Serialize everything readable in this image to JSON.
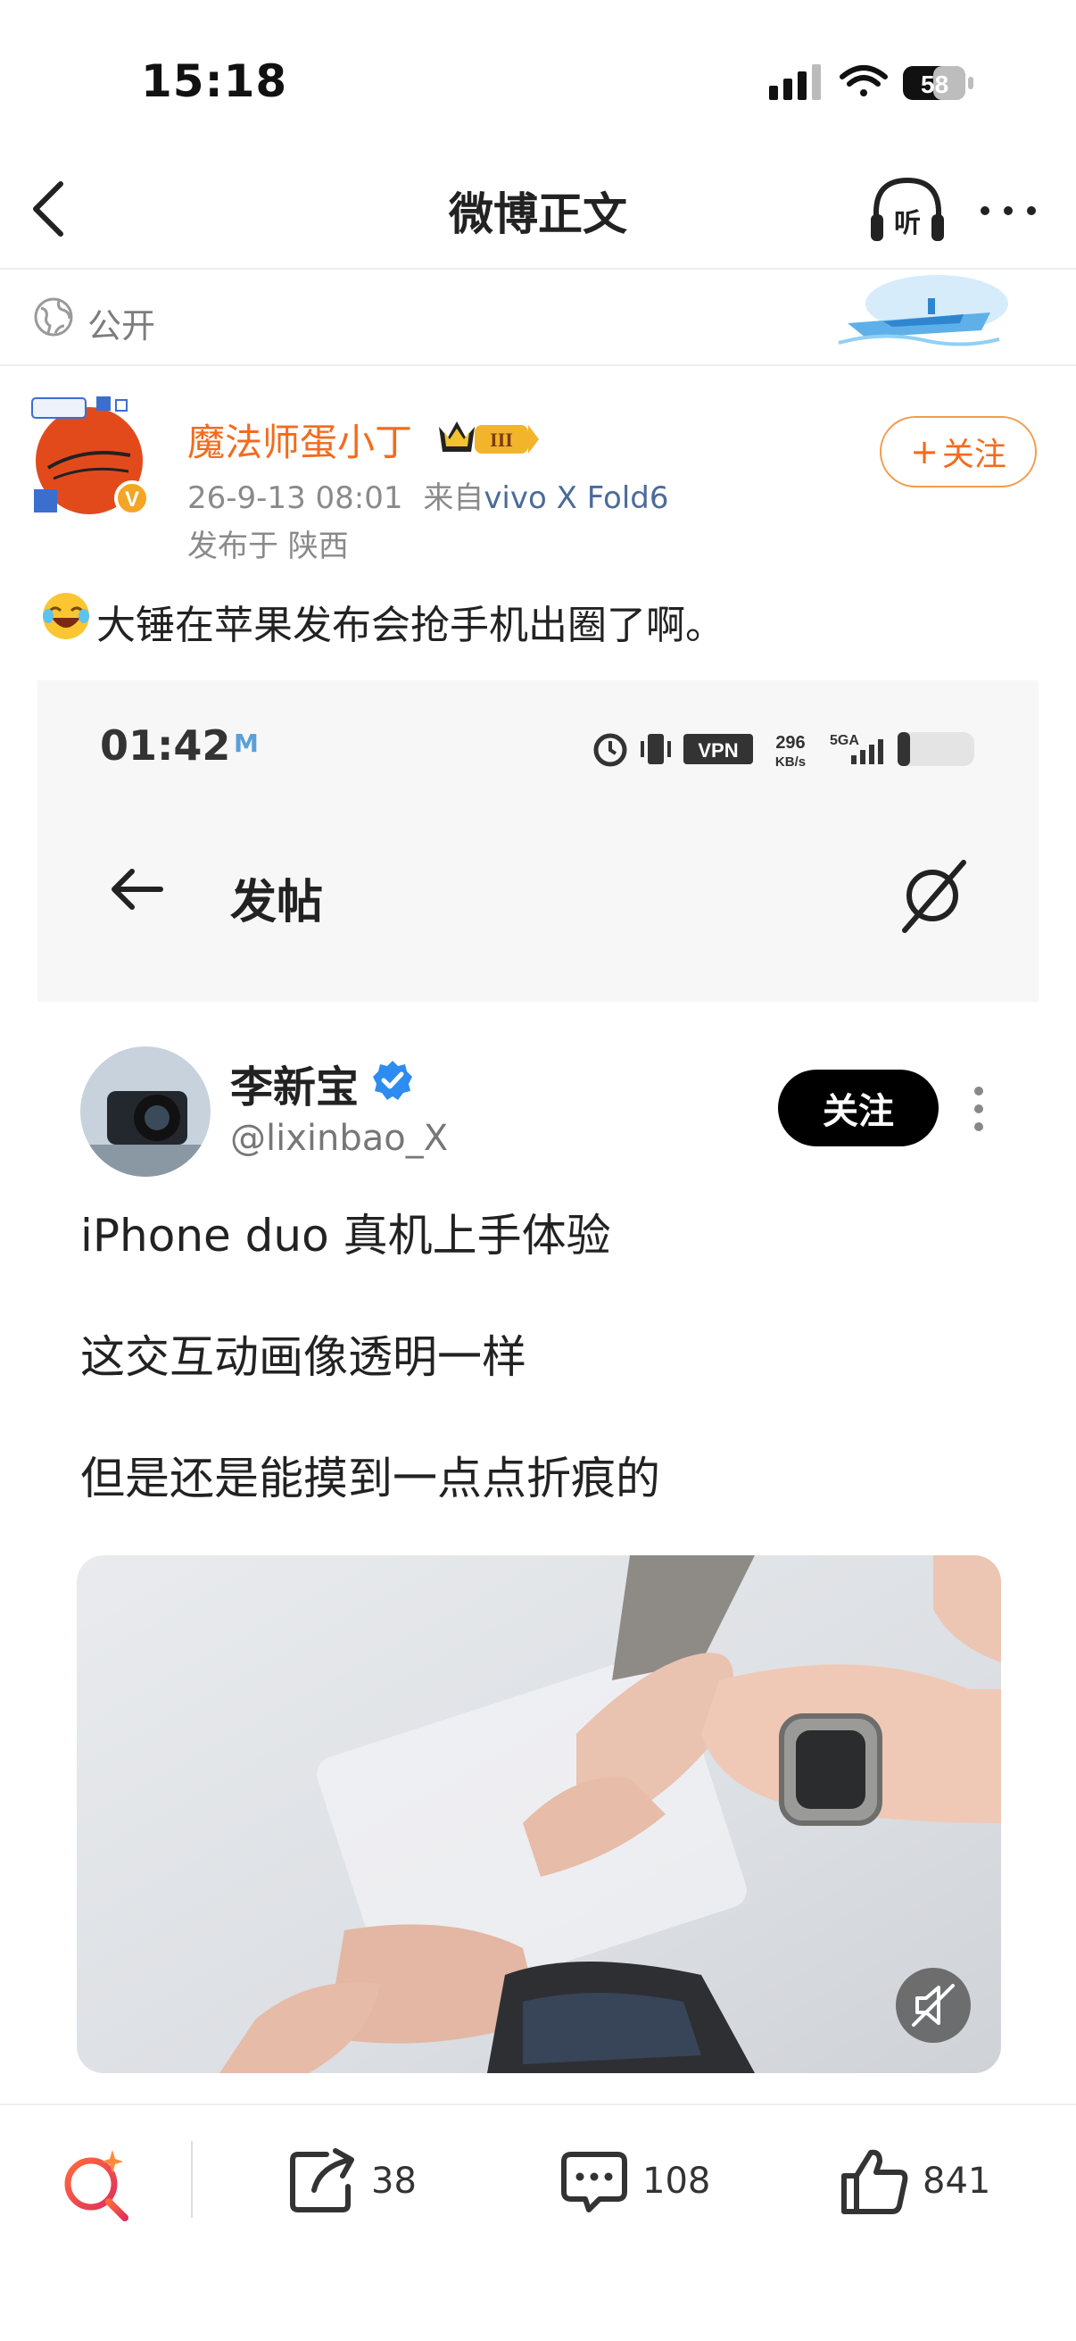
{
  "status_bar": {
    "time": "15:18",
    "battery": "58"
  },
  "nav": {
    "title": "微博正文",
    "listen_label": "听"
  },
  "visibility": {
    "label": "公开"
  },
  "author": {
    "name": "魔法师蛋小丁",
    "badge_level": "III",
    "timestamp": "26-9-13 08:01",
    "source_prefix": "来自",
    "source": "vivo X Fold6",
    "location": "发布于 陕西",
    "follow_label": "关注",
    "follow_plus": "+"
  },
  "post": {
    "text": "大锤在苹果发布会抢手机出圈了啊。"
  },
  "embedded": {
    "time": "01:42",
    "m_icon": "M",
    "vpn": "VPN",
    "speed": "296",
    "speed_unit": "KB/s",
    "network": "5GA",
    "header_title": "发帖",
    "author": "李新宝",
    "handle": "@lixinbao_X",
    "follow_label": "关注",
    "lines": [
      "iPhone duo 真机上手体验",
      "这交互动画像透明一样",
      "但是还是能摸到一点点折痕的"
    ]
  },
  "toolbar": {
    "repost_count": "38",
    "comment_count": "108",
    "like_count": "841"
  },
  "colors": {
    "accent": "#f36b1d",
    "link": "#4b6b9a",
    "gray_text": "#8a8a8a"
  },
  "icons": [
    "back-arrow-icon",
    "headphones-icon",
    "more-icon",
    "globe-icon",
    "crown-icon",
    "emoji-laugh-icon",
    "search-ai-icon",
    "repost-icon",
    "comment-icon",
    "like-icon",
    "mute-icon"
  ]
}
